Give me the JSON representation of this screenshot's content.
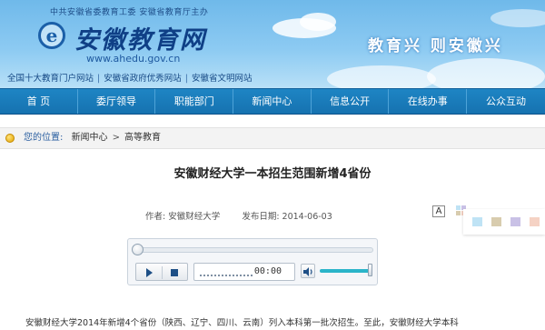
{
  "header": {
    "org_line": "中共安徽省委教育工委  安徽省教育厅主办",
    "logo_letter": "e",
    "logo_text": "安徽教育网",
    "domain": "www.ahedu.gov.cn",
    "slogan": "教育兴  则安徽兴",
    "quicklinks": [
      "全国十大教育门户网站",
      "安徽省政府优秀网站",
      "安徽省文明网站"
    ]
  },
  "nav": {
    "items": [
      "首  页",
      "委厅领导",
      "职能部门",
      "新闻中心",
      "信息公开",
      "在线办事",
      "公众互动"
    ]
  },
  "breadcrumb": {
    "label": "您的位置:",
    "items": [
      "新闻中心",
      "高等教育"
    ],
    "separator": ">"
  },
  "article": {
    "title": "安徽财经大学一本招生范围新增4省份",
    "author_label": "作者:",
    "author": "安徽财经大学",
    "date_label": "发布日期:",
    "date": "2014-06-03",
    "font_size_toggle": "A",
    "body_first_line": "安徽财经大学2014年新增4个省份（陕西、辽宁、四川、云南）列入本科第一批次招生。至此，安徽财经大学本科"
  },
  "colors": {
    "nav_bg": "#1672b0",
    "swatches": [
      "#bfe3f5",
      "#d8ccae",
      "#c9c1e6",
      "#f5d2c4"
    ]
  },
  "player": {
    "time": "00:00",
    "progress": 0,
    "volume": 1.0,
    "icons": [
      "play-icon",
      "stop-icon",
      "volume-icon"
    ]
  }
}
